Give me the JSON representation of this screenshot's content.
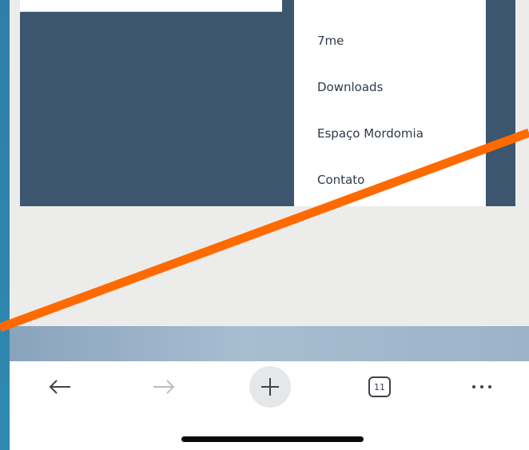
{
  "menu": {
    "items": [
      {
        "label": "7me"
      },
      {
        "label": "Downloads"
      },
      {
        "label": "Espaço Mordomia"
      },
      {
        "label": "Contato"
      }
    ]
  },
  "toolbar": {
    "tab_count": "11"
  },
  "icons": {
    "back": "arrow-left-icon",
    "forward": "arrow-right-icon",
    "new_tab": "plus-icon",
    "more": "ellipsis-icon"
  },
  "colors": {
    "header_dark": "#3b566e",
    "annotation_line": "#ff6a00",
    "left_strip": "#2f89b0",
    "page_gray": "#ececea"
  }
}
